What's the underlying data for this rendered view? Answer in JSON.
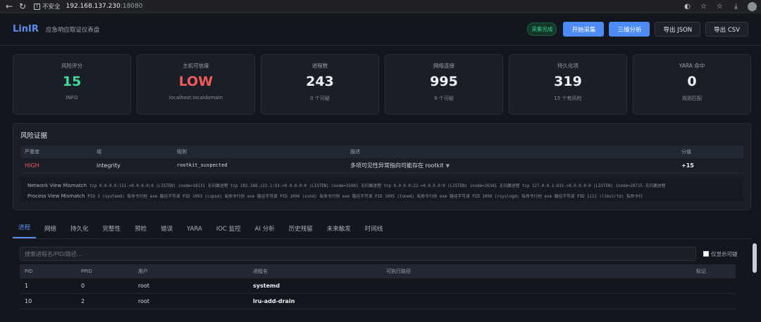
{
  "browser": {
    "insecure_label": "不安全",
    "host": "192.168.137.230",
    "port": ":18080"
  },
  "header": {
    "logo": "LinIR",
    "subtitle": "应急响应取证仪表盘",
    "status": "采集完成",
    "buttons": {
      "start": "开始采集",
      "analyze": "三维分析",
      "export_json": "导出 JSON",
      "export_csv": "导出 CSV"
    }
  },
  "cards": [
    {
      "label": "风险评分",
      "value": "15",
      "sub": "INFO",
      "color": "#3ddc97"
    },
    {
      "label": "主机可信度",
      "value": "LOW",
      "sub": "localhost.localdomain",
      "color": "#f05a5a"
    },
    {
      "label": "进程数",
      "value": "243",
      "sub": "0 个可疑"
    },
    {
      "label": "网络连接",
      "value": "995",
      "sub": "9 个可疑"
    },
    {
      "label": "持久化项",
      "value": "319",
      "sub": "15 个有风险"
    },
    {
      "label": "YARA 命中",
      "value": "0",
      "sub": "规则匹配"
    }
  ],
  "risk": {
    "title": "风险证据",
    "columns": {
      "severity": "严重度",
      "domain": "域",
      "rule": "规则",
      "description": "描述",
      "score": "分值"
    },
    "rows": [
      {
        "severity": "HIGH",
        "domain": "integrity",
        "rule": "rootkit_suspected",
        "description": "多项可见性异常指向可能存在 rootkit",
        "score": "+15"
      }
    ],
    "evidence": [
      {
        "label": "Network View Mismatch",
        "text": "tcp 0.0.0.0:111->0.0.0.0:0 (LISTEN) inode=18131 无归属进程  tcp 192.168.122.1:53->0.0.0.0:0 (LISTEN) inode=31061 无归属进程  tcp 0.0.0.0:22->0.0.0.0:0 (LISTEN) inode=26341 无归属进程  tcp 127.0.0.1:631->0.0.0.0:0 (LISTEN) inode=28715 无归属进程"
      },
      {
        "label": "Process View Mismatch",
        "text": "PID 1 (systemd) 有命令行但 exe 路径不可读  PID 1093 (cupsd) 有命令行但 exe 路径不可读  PID 1094 (sshd) 有命令行但 exe 路径不可读  PID 1095 (tuned) 有命令行但 exe 路径不可读  PID 1099 (rsyslogd) 有命令行但 exe 路径不可读  PID 1111 (libvirtd) 有命令行"
      }
    ]
  },
  "tabs": [
    "进程",
    "网络",
    "持久化",
    "完整性",
    "预检",
    "错误",
    "YARA",
    "IOC 监控",
    "AI 分析",
    "历史残留",
    "未来触发",
    "时间线"
  ],
  "process": {
    "search_placeholder": "搜索进程名/PID/路径...",
    "suspicious_only": "仅显示可疑",
    "columns": {
      "pid": "PID",
      "ppid": "PPID",
      "user": "用户",
      "name": "进程名",
      "exe": "可执行路径",
      "tag": "标记"
    },
    "rows": [
      {
        "pid": "1",
        "ppid": "0",
        "user": "root",
        "name": "systemd",
        "exe": "",
        "tag": ""
      },
      {
        "pid": "10",
        "ppid": "2",
        "user": "root",
        "name": "lru-add-drain",
        "exe": "",
        "tag": ""
      }
    ]
  }
}
